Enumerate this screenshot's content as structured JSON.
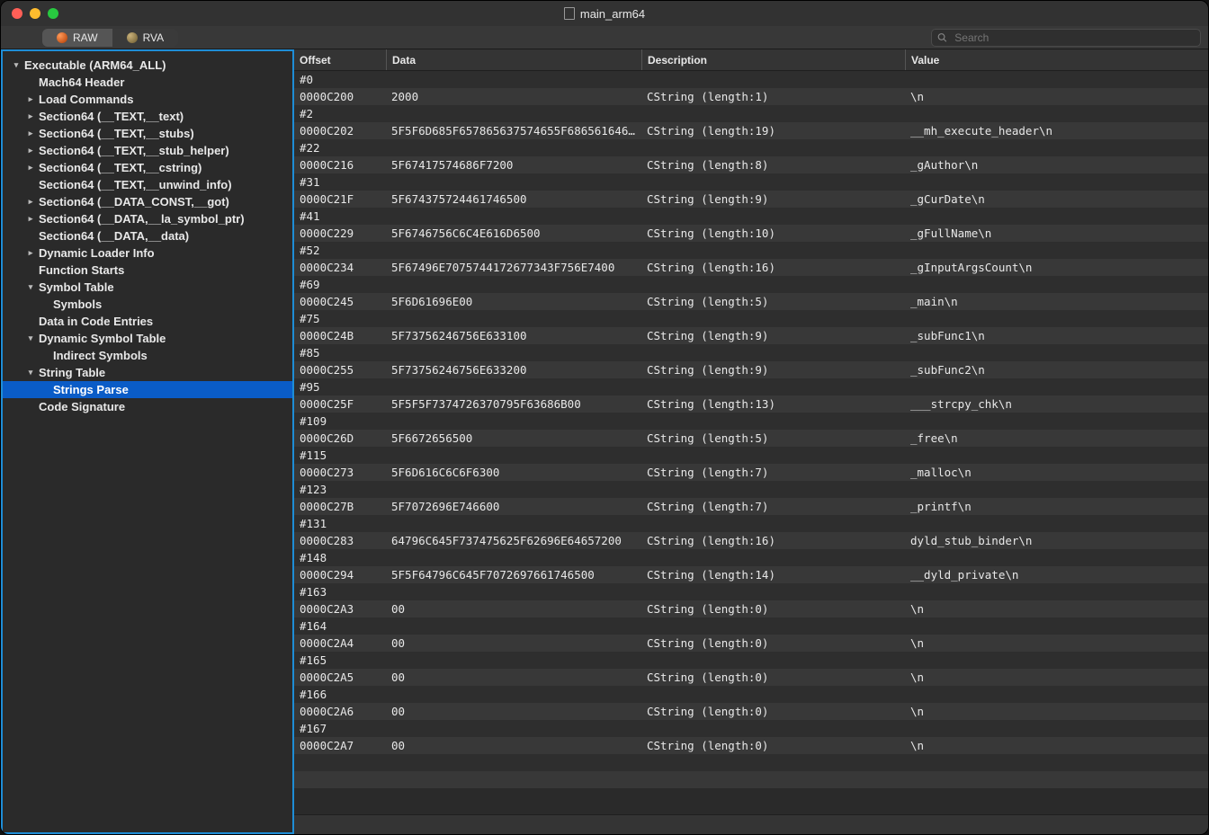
{
  "window": {
    "title": "main_arm64"
  },
  "toolbar": {
    "tabs": [
      {
        "label": "RAW",
        "active": true
      },
      {
        "label": "RVA",
        "active": false
      }
    ],
    "search_placeholder": "Search"
  },
  "sidebar": {
    "items": [
      {
        "label": "Executable  (ARM64_ALL)",
        "indent": 0,
        "disclosure": "open"
      },
      {
        "label": "Mach64 Header",
        "indent": 1,
        "disclosure": "none"
      },
      {
        "label": "Load Commands",
        "indent": 1,
        "disclosure": "closed"
      },
      {
        "label": "Section64 (__TEXT,__text)",
        "indent": 1,
        "disclosure": "closed"
      },
      {
        "label": "Section64 (__TEXT,__stubs)",
        "indent": 1,
        "disclosure": "closed"
      },
      {
        "label": "Section64 (__TEXT,__stub_helper)",
        "indent": 1,
        "disclosure": "closed"
      },
      {
        "label": "Section64 (__TEXT,__cstring)",
        "indent": 1,
        "disclosure": "closed"
      },
      {
        "label": "Section64 (__TEXT,__unwind_info)",
        "indent": 1,
        "disclosure": "none"
      },
      {
        "label": "Section64 (__DATA_CONST,__got)",
        "indent": 1,
        "disclosure": "closed"
      },
      {
        "label": "Section64 (__DATA,__la_symbol_ptr)",
        "indent": 1,
        "disclosure": "closed"
      },
      {
        "label": "Section64 (__DATA,__data)",
        "indent": 1,
        "disclosure": "none"
      },
      {
        "label": "Dynamic Loader Info",
        "indent": 1,
        "disclosure": "closed"
      },
      {
        "label": "Function Starts",
        "indent": 1,
        "disclosure": "none"
      },
      {
        "label": "Symbol Table",
        "indent": 1,
        "disclosure": "open"
      },
      {
        "label": "Symbols",
        "indent": 2,
        "disclosure": "none"
      },
      {
        "label": "Data in Code Entries",
        "indent": 1,
        "disclosure": "none"
      },
      {
        "label": "Dynamic Symbol Table",
        "indent": 1,
        "disclosure": "open"
      },
      {
        "label": "Indirect Symbols",
        "indent": 2,
        "disclosure": "none"
      },
      {
        "label": "String Table",
        "indent": 1,
        "disclosure": "open"
      },
      {
        "label": "Strings Parse",
        "indent": 2,
        "disclosure": "none",
        "selected": true
      },
      {
        "label": "Code Signature",
        "indent": 1,
        "disclosure": "none"
      }
    ]
  },
  "grid": {
    "columns": [
      {
        "key": "offset",
        "label": "Offset"
      },
      {
        "key": "data",
        "label": "Data"
      },
      {
        "key": "desc",
        "label": "Description"
      },
      {
        "key": "value",
        "label": "Value"
      }
    ],
    "rows": [
      {
        "offset": "#0",
        "data": "",
        "desc": "",
        "value": ""
      },
      {
        "offset": "0000C200",
        "data": "2000",
        "desc": "CString (length:1)",
        "value": " \\n"
      },
      {
        "offset": "#2",
        "data": "",
        "desc": "",
        "value": ""
      },
      {
        "offset": "0000C202",
        "data": "5F5F6D685F657865637574655F686561646572…",
        "desc": "CString (length:19)",
        "value": "__mh_execute_header\\n"
      },
      {
        "offset": "#22",
        "data": "",
        "desc": "",
        "value": ""
      },
      {
        "offset": "0000C216",
        "data": "5F67417574686F7200",
        "desc": "CString (length:8)",
        "value": "_gAuthor\\n"
      },
      {
        "offset": "#31",
        "data": "",
        "desc": "",
        "value": ""
      },
      {
        "offset": "0000C21F",
        "data": "5F674375724461746500",
        "desc": "CString (length:9)",
        "value": "_gCurDate\\n"
      },
      {
        "offset": "#41",
        "data": "",
        "desc": "",
        "value": ""
      },
      {
        "offset": "0000C229",
        "data": "5F6746756C6C4E616D6500",
        "desc": "CString (length:10)",
        "value": "_gFullName\\n"
      },
      {
        "offset": "#52",
        "data": "",
        "desc": "",
        "value": ""
      },
      {
        "offset": "0000C234",
        "data": "5F67496E7075744172677343F756E7400",
        "desc": "CString (length:16)",
        "value": "_gInputArgsCount\\n"
      },
      {
        "offset": "#69",
        "data": "",
        "desc": "",
        "value": ""
      },
      {
        "offset": "0000C245",
        "data": "5F6D61696E00",
        "desc": "CString (length:5)",
        "value": "_main\\n"
      },
      {
        "offset": "#75",
        "data": "",
        "desc": "",
        "value": ""
      },
      {
        "offset": "0000C24B",
        "data": "5F73756246756E633100",
        "desc": "CString (length:9)",
        "value": "_subFunc1\\n"
      },
      {
        "offset": "#85",
        "data": "",
        "desc": "",
        "value": ""
      },
      {
        "offset": "0000C255",
        "data": "5F73756246756E633200",
        "desc": "CString (length:9)",
        "value": "_subFunc2\\n"
      },
      {
        "offset": "#95",
        "data": "",
        "desc": "",
        "value": ""
      },
      {
        "offset": "0000C25F",
        "data": "5F5F5F7374726370795F63686B00",
        "desc": "CString (length:13)",
        "value": "___strcpy_chk\\n"
      },
      {
        "offset": "#109",
        "data": "",
        "desc": "",
        "value": ""
      },
      {
        "offset": "0000C26D",
        "data": "5F6672656500",
        "desc": "CString (length:5)",
        "value": "_free\\n"
      },
      {
        "offset": "#115",
        "data": "",
        "desc": "",
        "value": ""
      },
      {
        "offset": "0000C273",
        "data": "5F6D616C6C6F6300",
        "desc": "CString (length:7)",
        "value": "_malloc\\n"
      },
      {
        "offset": "#123",
        "data": "",
        "desc": "",
        "value": ""
      },
      {
        "offset": "0000C27B",
        "data": "5F7072696E746600",
        "desc": "CString (length:7)",
        "value": "_printf\\n"
      },
      {
        "offset": "#131",
        "data": "",
        "desc": "",
        "value": ""
      },
      {
        "offset": "0000C283",
        "data": "64796C645F737475625F62696E64657200",
        "desc": "CString (length:16)",
        "value": "dyld_stub_binder\\n"
      },
      {
        "offset": "#148",
        "data": "",
        "desc": "",
        "value": ""
      },
      {
        "offset": "0000C294",
        "data": "5F5F64796C645F7072697661746500",
        "desc": "CString (length:14)",
        "value": "__dyld_private\\n"
      },
      {
        "offset": "#163",
        "data": "",
        "desc": "",
        "value": ""
      },
      {
        "offset": "0000C2A3",
        "data": "00",
        "desc": "CString (length:0)",
        "value": "\\n"
      },
      {
        "offset": "#164",
        "data": "",
        "desc": "",
        "value": ""
      },
      {
        "offset": "0000C2A4",
        "data": "00",
        "desc": "CString (length:0)",
        "value": "\\n"
      },
      {
        "offset": "#165",
        "data": "",
        "desc": "",
        "value": ""
      },
      {
        "offset": "0000C2A5",
        "data": "00",
        "desc": "CString (length:0)",
        "value": "\\n"
      },
      {
        "offset": "#166",
        "data": "",
        "desc": "",
        "value": ""
      },
      {
        "offset": "0000C2A6",
        "data": "00",
        "desc": "CString (length:0)",
        "value": "\\n"
      },
      {
        "offset": "#167",
        "data": "",
        "desc": "",
        "value": ""
      },
      {
        "offset": "0000C2A7",
        "data": "00",
        "desc": "CString (length:0)",
        "value": "\\n"
      }
    ]
  }
}
